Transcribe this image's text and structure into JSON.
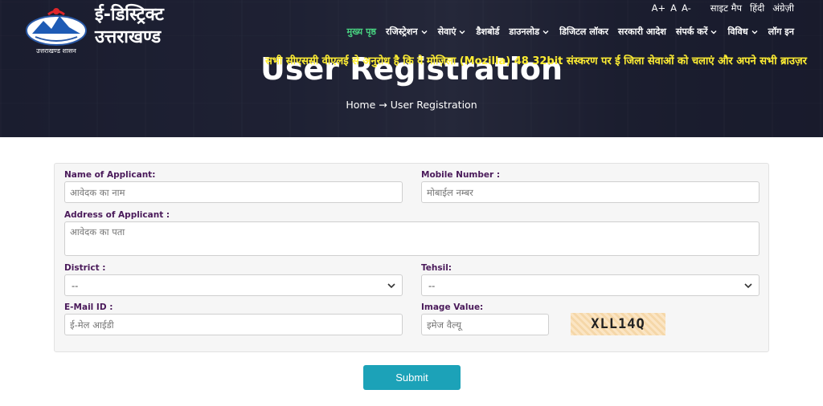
{
  "brand": {
    "title": "ई-डिस्ट्रिक्ट",
    "subtitle": "उत्तराखण्ड",
    "emblem_text": "उत्तराखण्ड शासन"
  },
  "util": {
    "font_large": "A+",
    "font_normal": "A",
    "font_small": "A-",
    "sitemap": "साइट मैप",
    "hindi": "हिंदी",
    "english": "अंग्रेज़ी"
  },
  "nav": [
    {
      "label": "मुख्य पृष्ठ",
      "dropdown": false,
      "active": true
    },
    {
      "label": "रजिस्ट्रेशन",
      "dropdown": true
    },
    {
      "label": "सेवाएं",
      "dropdown": true
    },
    {
      "label": "डैशबोर्ड",
      "dropdown": false
    },
    {
      "label": "डाउनलोड",
      "dropdown": true
    },
    {
      "label": "डिजिटल लॉकर",
      "dropdown": false
    },
    {
      "label": "सरकारी आदेश",
      "dropdown": false
    },
    {
      "label": "संपर्क करें",
      "dropdown": true
    },
    {
      "label": "विविध",
      "dropdown": true
    },
    {
      "label": "लॉग इन",
      "dropdown": false
    }
  ],
  "ticker": "सभी सीएससी वीएलई से अनुरोध है कि वे मोज़िला (Mozilla) 48 32bit संस्करण पर ई जिला सेवाओं को चलाएं और अपने सभी ब्राउज़र",
  "page": {
    "title": "User Registration",
    "breadcrumb_home": "Home",
    "breadcrumb_arrow": "→",
    "breadcrumb_current": "User Registration"
  },
  "form": {
    "name_label": "Name of Applicant:",
    "name_placeholder": "आवेदक का नाम",
    "mobile_label": "Mobile Number :",
    "mobile_placeholder": "मोबाईल नम्बर",
    "address_label": "Address of Applicant :",
    "address_placeholder": "आवेदक का पता",
    "district_label": "District :",
    "district_value": "--",
    "tehsil_label": "Tehsil:",
    "tehsil_value": "--",
    "email_label": "E-Mail ID :",
    "email_placeholder": "ई-मेल आईडी",
    "image_label": "Image Value:",
    "image_placeholder": "इमेज वैल्यू",
    "captcha": "XLL14Q",
    "submit": "Submit"
  },
  "colors": {
    "accent": "#1ca2b8",
    "nav_active": "#48d180",
    "ticker": "#ffee33",
    "label": "#4a1a5a"
  }
}
